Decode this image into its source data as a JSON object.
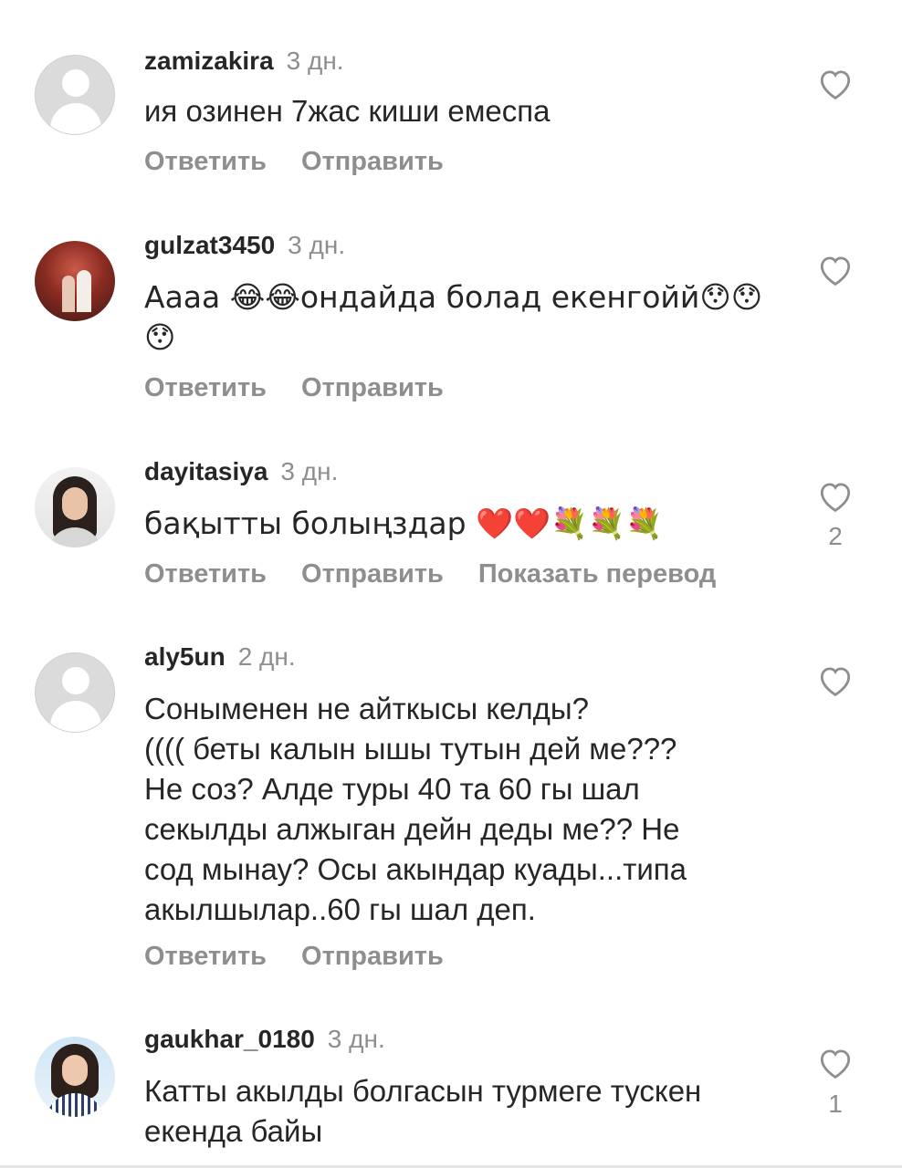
{
  "actions": {
    "reply": "Ответить",
    "send": "Отправить",
    "translate": "Показать перевод"
  },
  "comments": [
    {
      "username": "zamizakira",
      "time": "3 дн.",
      "text": "ия озинен 7жас киши емеспа",
      "likes": null,
      "avatar": "default-avatar"
    },
    {
      "username": "gulzat3450",
      "time": "3 дн.",
      "text": "Аааа 😂😂ондайда болад екенгойй😯😯\n😯",
      "likes": null,
      "avatar": "couple-photo"
    },
    {
      "username": "dayitasiya",
      "time": "3 дн.",
      "text": "бақытты болыңздар ❤️❤️💐💐💐",
      "likes": "2",
      "avatar": "woman-photo"
    },
    {
      "username": "aly5un",
      "time": "2 дн.",
      "text": "Сонымен­ен не айткысы келды?\n(((( беты калын ышы тутын дей ме???\nНе соз? Алде туры 40 та 60 гы шал\nсекылды алжыган дейн деды ме?? Не\nсод мынау? Осы акындар куады...типа\nакылшылар..60 гы шал деп.",
      "likes": null,
      "avatar": "default-avatar"
    },
    {
      "username": "gaukhar_0180",
      "time": "3 дн.",
      "text": "Катты акылды болгасын турмеге тускен\nекенда байы",
      "likes": "1",
      "avatar": "woman-photo"
    }
  ]
}
